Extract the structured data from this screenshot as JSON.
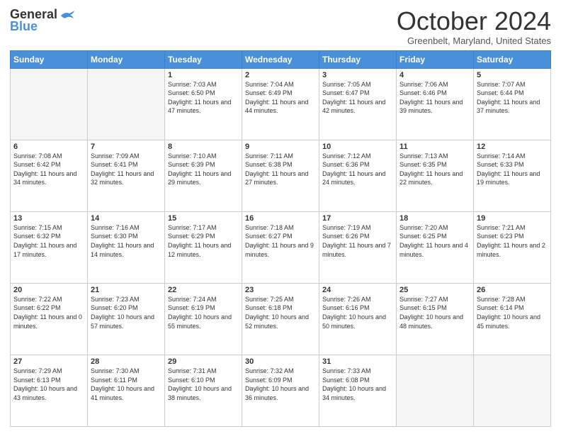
{
  "header": {
    "logo_line1": "General",
    "logo_line2": "Blue",
    "month": "October 2024",
    "location": "Greenbelt, Maryland, United States"
  },
  "days_of_week": [
    "Sunday",
    "Monday",
    "Tuesday",
    "Wednesday",
    "Thursday",
    "Friday",
    "Saturday"
  ],
  "weeks": [
    [
      {
        "day": "",
        "sunrise": "",
        "sunset": "",
        "daylight": "",
        "empty": true
      },
      {
        "day": "",
        "sunrise": "",
        "sunset": "",
        "daylight": "",
        "empty": true
      },
      {
        "day": "1",
        "sunrise": "Sunrise: 7:03 AM",
        "sunset": "Sunset: 6:50 PM",
        "daylight": "Daylight: 11 hours and 47 minutes."
      },
      {
        "day": "2",
        "sunrise": "Sunrise: 7:04 AM",
        "sunset": "Sunset: 6:49 PM",
        "daylight": "Daylight: 11 hours and 44 minutes."
      },
      {
        "day": "3",
        "sunrise": "Sunrise: 7:05 AM",
        "sunset": "Sunset: 6:47 PM",
        "daylight": "Daylight: 11 hours and 42 minutes."
      },
      {
        "day": "4",
        "sunrise": "Sunrise: 7:06 AM",
        "sunset": "Sunset: 6:46 PM",
        "daylight": "Daylight: 11 hours and 39 minutes."
      },
      {
        "day": "5",
        "sunrise": "Sunrise: 7:07 AM",
        "sunset": "Sunset: 6:44 PM",
        "daylight": "Daylight: 11 hours and 37 minutes."
      }
    ],
    [
      {
        "day": "6",
        "sunrise": "Sunrise: 7:08 AM",
        "sunset": "Sunset: 6:42 PM",
        "daylight": "Daylight: 11 hours and 34 minutes."
      },
      {
        "day": "7",
        "sunrise": "Sunrise: 7:09 AM",
        "sunset": "Sunset: 6:41 PM",
        "daylight": "Daylight: 11 hours and 32 minutes."
      },
      {
        "day": "8",
        "sunrise": "Sunrise: 7:10 AM",
        "sunset": "Sunset: 6:39 PM",
        "daylight": "Daylight: 11 hours and 29 minutes."
      },
      {
        "day": "9",
        "sunrise": "Sunrise: 7:11 AM",
        "sunset": "Sunset: 6:38 PM",
        "daylight": "Daylight: 11 hours and 27 minutes."
      },
      {
        "day": "10",
        "sunrise": "Sunrise: 7:12 AM",
        "sunset": "Sunset: 6:36 PM",
        "daylight": "Daylight: 11 hours and 24 minutes."
      },
      {
        "day": "11",
        "sunrise": "Sunrise: 7:13 AM",
        "sunset": "Sunset: 6:35 PM",
        "daylight": "Daylight: 11 hours and 22 minutes."
      },
      {
        "day": "12",
        "sunrise": "Sunrise: 7:14 AM",
        "sunset": "Sunset: 6:33 PM",
        "daylight": "Daylight: 11 hours and 19 minutes."
      }
    ],
    [
      {
        "day": "13",
        "sunrise": "Sunrise: 7:15 AM",
        "sunset": "Sunset: 6:32 PM",
        "daylight": "Daylight: 11 hours and 17 minutes."
      },
      {
        "day": "14",
        "sunrise": "Sunrise: 7:16 AM",
        "sunset": "Sunset: 6:30 PM",
        "daylight": "Daylight: 11 hours and 14 minutes."
      },
      {
        "day": "15",
        "sunrise": "Sunrise: 7:17 AM",
        "sunset": "Sunset: 6:29 PM",
        "daylight": "Daylight: 11 hours and 12 minutes."
      },
      {
        "day": "16",
        "sunrise": "Sunrise: 7:18 AM",
        "sunset": "Sunset: 6:27 PM",
        "daylight": "Daylight: 11 hours and 9 minutes."
      },
      {
        "day": "17",
        "sunrise": "Sunrise: 7:19 AM",
        "sunset": "Sunset: 6:26 PM",
        "daylight": "Daylight: 11 hours and 7 minutes."
      },
      {
        "day": "18",
        "sunrise": "Sunrise: 7:20 AM",
        "sunset": "Sunset: 6:25 PM",
        "daylight": "Daylight: 11 hours and 4 minutes."
      },
      {
        "day": "19",
        "sunrise": "Sunrise: 7:21 AM",
        "sunset": "Sunset: 6:23 PM",
        "daylight": "Daylight: 11 hours and 2 minutes."
      }
    ],
    [
      {
        "day": "20",
        "sunrise": "Sunrise: 7:22 AM",
        "sunset": "Sunset: 6:22 PM",
        "daylight": "Daylight: 11 hours and 0 minutes."
      },
      {
        "day": "21",
        "sunrise": "Sunrise: 7:23 AM",
        "sunset": "Sunset: 6:20 PM",
        "daylight": "Daylight: 10 hours and 57 minutes."
      },
      {
        "day": "22",
        "sunrise": "Sunrise: 7:24 AM",
        "sunset": "Sunset: 6:19 PM",
        "daylight": "Daylight: 10 hours and 55 minutes."
      },
      {
        "day": "23",
        "sunrise": "Sunrise: 7:25 AM",
        "sunset": "Sunset: 6:18 PM",
        "daylight": "Daylight: 10 hours and 52 minutes."
      },
      {
        "day": "24",
        "sunrise": "Sunrise: 7:26 AM",
        "sunset": "Sunset: 6:16 PM",
        "daylight": "Daylight: 10 hours and 50 minutes."
      },
      {
        "day": "25",
        "sunrise": "Sunrise: 7:27 AM",
        "sunset": "Sunset: 6:15 PM",
        "daylight": "Daylight: 10 hours and 48 minutes."
      },
      {
        "day": "26",
        "sunrise": "Sunrise: 7:28 AM",
        "sunset": "Sunset: 6:14 PM",
        "daylight": "Daylight: 10 hours and 45 minutes."
      }
    ],
    [
      {
        "day": "27",
        "sunrise": "Sunrise: 7:29 AM",
        "sunset": "Sunset: 6:13 PM",
        "daylight": "Daylight: 10 hours and 43 minutes."
      },
      {
        "day": "28",
        "sunrise": "Sunrise: 7:30 AM",
        "sunset": "Sunset: 6:11 PM",
        "daylight": "Daylight: 10 hours and 41 minutes."
      },
      {
        "day": "29",
        "sunrise": "Sunrise: 7:31 AM",
        "sunset": "Sunset: 6:10 PM",
        "daylight": "Daylight: 10 hours and 38 minutes."
      },
      {
        "day": "30",
        "sunrise": "Sunrise: 7:32 AM",
        "sunset": "Sunset: 6:09 PM",
        "daylight": "Daylight: 10 hours and 36 minutes."
      },
      {
        "day": "31",
        "sunrise": "Sunrise: 7:33 AM",
        "sunset": "Sunset: 6:08 PM",
        "daylight": "Daylight: 10 hours and 34 minutes."
      },
      {
        "day": "",
        "sunrise": "",
        "sunset": "",
        "daylight": "",
        "empty": true
      },
      {
        "day": "",
        "sunrise": "",
        "sunset": "",
        "daylight": "",
        "empty": true
      }
    ]
  ]
}
